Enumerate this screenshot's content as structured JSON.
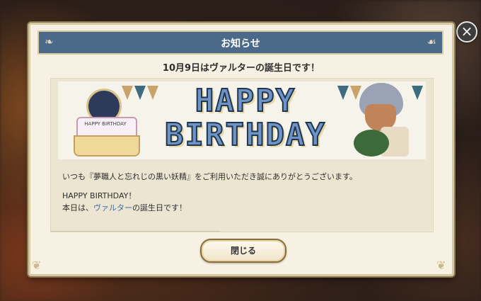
{
  "dialog": {
    "title": "お知らせ",
    "headline": "10月9日はヴァルターの誕生日です！",
    "banner": {
      "text_line1": "HAPPY",
      "text_line2": "BIRTHDAY",
      "cake_text": "HAPPY BIRTHDAY"
    },
    "message": {
      "intro": "いつも『夢職人と忘れじの黒い妖精』をご利用いただき誠にありがとうございます。",
      "greeting": "HAPPY BIRTHDAY！",
      "line_prefix": "本日は、",
      "line_name": "ヴァルター",
      "line_suffix": "の誕生日です！"
    },
    "close_button_label": "閉じる"
  },
  "window_controls": {
    "close_icon": "close-icon",
    "close_glyph": "×"
  },
  "colors": {
    "title_bar": "#4b6a8a",
    "dialog_bg": "#f6f1e2",
    "highlight_name": "#3f6da3",
    "banner_text": "#6e94c6"
  }
}
